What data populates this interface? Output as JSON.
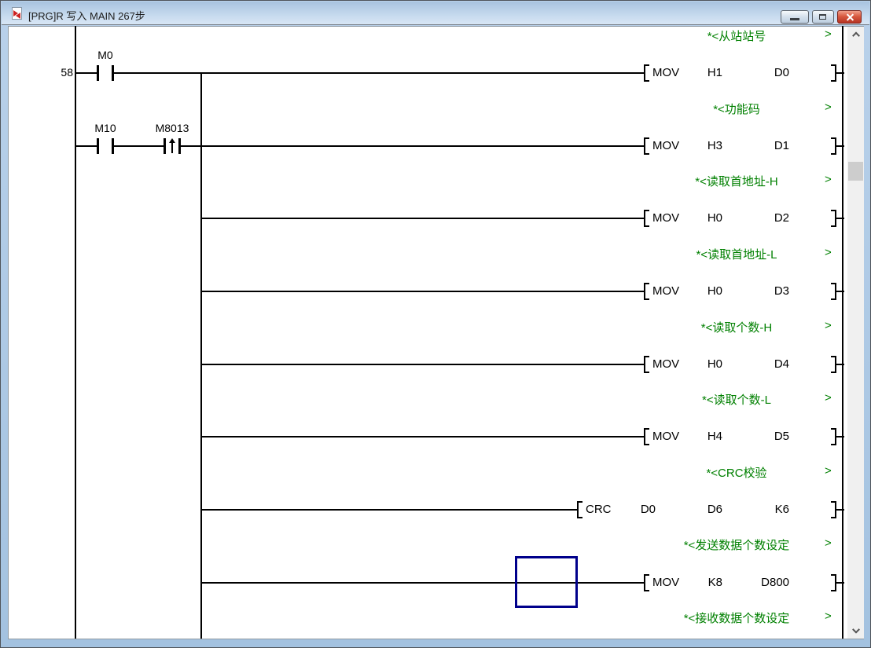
{
  "window": {
    "title": "[PRG]R 写入 MAIN 267步",
    "icon": "program-document-icon",
    "controls": [
      {
        "name": "minimize",
        "glyph": "minimize-icon"
      },
      {
        "name": "maximize",
        "glyph": "maximize-icon"
      },
      {
        "name": "close",
        "glyph": "close-icon"
      }
    ]
  },
  "colors": {
    "comment_green": "#008000",
    "selection_blue": "#00008B",
    "ladder_line": "#000000",
    "close_button_red": "#C8402C"
  },
  "ladder": {
    "continuation_marker": ">",
    "comments": [
      "*<从站站号",
      "*<功能码",
      "*<读取首地址-H",
      "*<读取首地址-L",
      "*<读取个数-H",
      "*<读取个数-L",
      "*<CRC校验",
      "*<发送数据个数设定",
      "*<接收数据个数设定"
    ],
    "rungs": [
      {
        "step": "58",
        "source": "left-rail",
        "contacts": [
          {
            "device": "M0",
            "type": "normally-open"
          }
        ],
        "instruction": {
          "mnemonic": "MOV",
          "operands": [
            "H1",
            "D0"
          ]
        }
      },
      {
        "step": "",
        "source": "left-rail",
        "contacts": [
          {
            "device": "M10",
            "type": "normally-open"
          },
          {
            "device": "M8013",
            "type": "rising-pulse"
          }
        ],
        "instruction": {
          "mnemonic": "MOV",
          "operands": [
            "H3",
            "D1"
          ]
        }
      },
      {
        "step": "",
        "source": "branch",
        "contacts": [],
        "instruction": {
          "mnemonic": "MOV",
          "operands": [
            "H0",
            "D2"
          ]
        }
      },
      {
        "step": "",
        "source": "branch",
        "contacts": [],
        "instruction": {
          "mnemonic": "MOV",
          "operands": [
            "H0",
            "D3"
          ]
        }
      },
      {
        "step": "",
        "source": "branch",
        "contacts": [],
        "instruction": {
          "mnemonic": "MOV",
          "operands": [
            "H0",
            "D4"
          ]
        }
      },
      {
        "step": "",
        "source": "branch",
        "contacts": [],
        "instruction": {
          "mnemonic": "MOV",
          "operands": [
            "H4",
            "D5"
          ]
        }
      },
      {
        "step": "",
        "source": "branch",
        "contacts": [],
        "instruction": {
          "mnemonic": "CRC",
          "operands": [
            "D0",
            "D6",
            "K6"
          ]
        }
      },
      {
        "step": "",
        "source": "branch",
        "contacts": [],
        "instruction": {
          "mnemonic": "MOV",
          "operands": [
            "K8",
            "D800"
          ]
        },
        "selected": true
      }
    ]
  },
  "scrollbar": {
    "up": "chevron-up-icon",
    "down": "chevron-down-icon"
  }
}
